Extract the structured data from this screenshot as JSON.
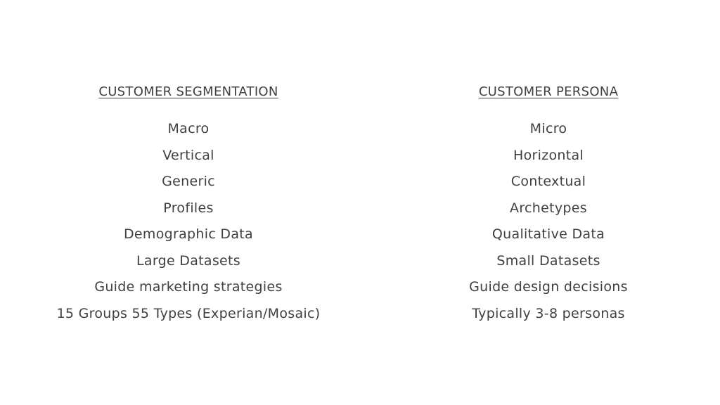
{
  "segmentation": {
    "heading": "CUSTOMER SEGMENTATION",
    "items": [
      "Macro",
      "Vertical",
      "Generic",
      "Profiles",
      "Demographic Data",
      "Large Datasets",
      "Guide marketing strategies",
      "15 Groups 55 Types (Experian/Mosaic)"
    ]
  },
  "persona": {
    "heading": "CUSTOMER PERSONA",
    "items": [
      "Micro",
      "Horizontal",
      "Contextual",
      "Archetypes",
      "Qualitative Data",
      "Small Datasets",
      "Guide design decisions",
      "Typically 3-8 personas"
    ]
  }
}
